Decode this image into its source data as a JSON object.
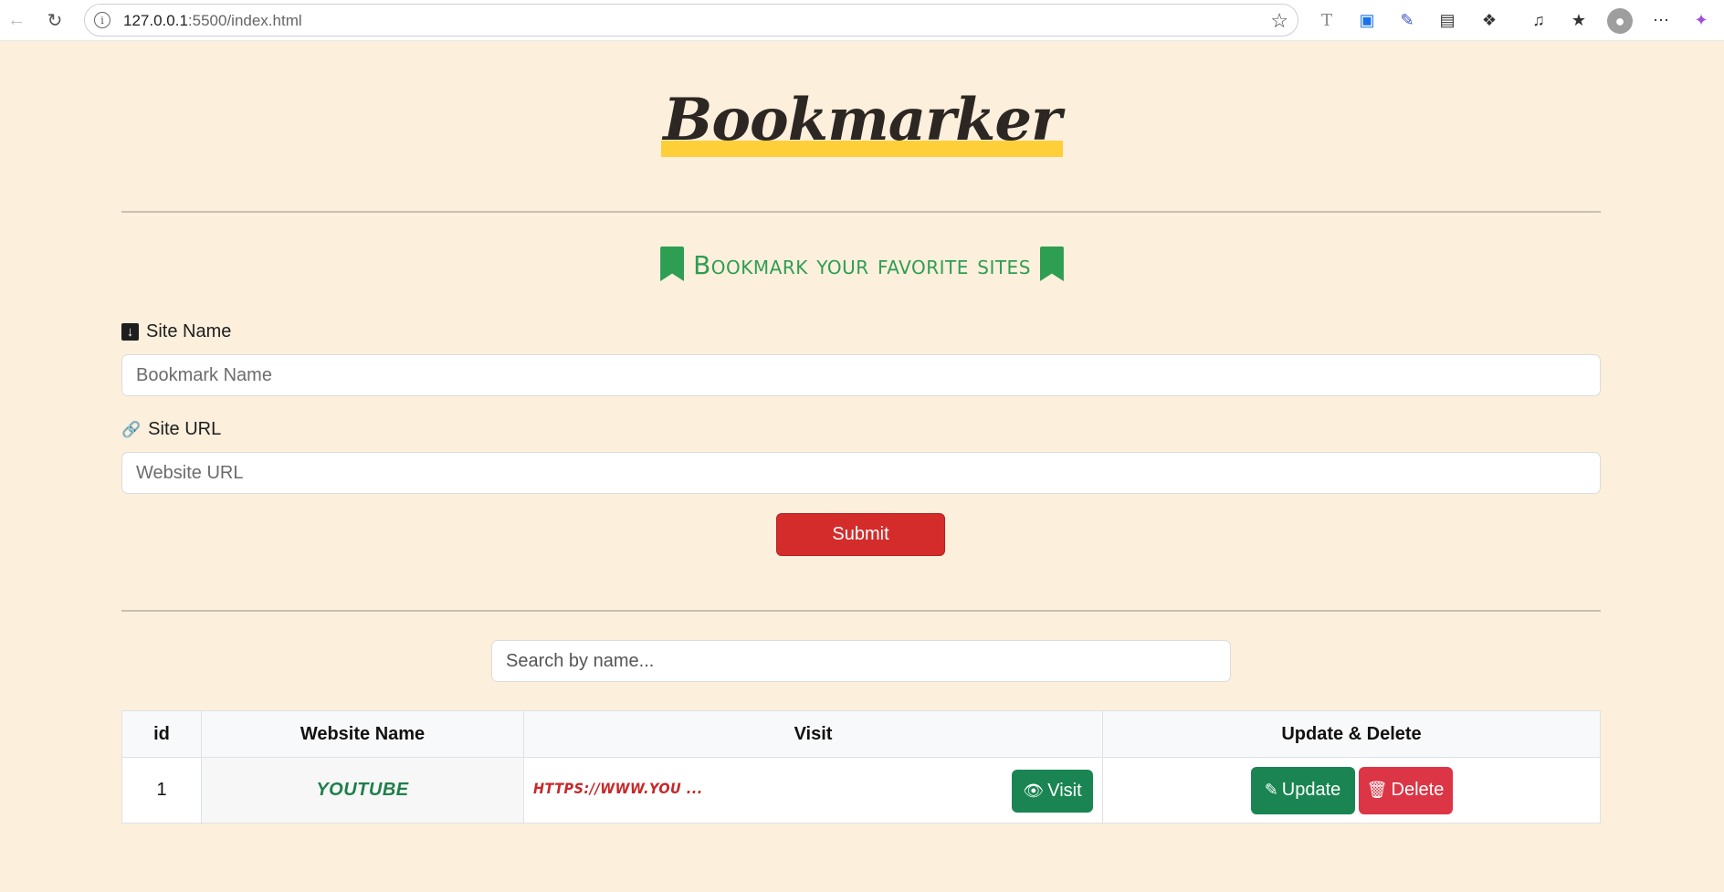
{
  "browser": {
    "url_host": "127.0.0.1",
    "url_rest": ":5500/index.html"
  },
  "page": {
    "logo": "Bookmarker",
    "subtitle": "Bookmark your favorite sites",
    "site_name_label": "Site Name",
    "site_name_placeholder": "Bookmark Name",
    "site_url_label": "Site URL",
    "site_url_placeholder": "Website URL",
    "submit_label": "Submit",
    "search_placeholder": "Search by name..."
  },
  "table": {
    "headers": [
      "id",
      "Website Name",
      "Visit",
      "Update & Delete"
    ],
    "rows": [
      {
        "id": "1",
        "name": "YOUTUBE",
        "url": "HTTPS://WWW.YOU ...",
        "visit_label": "Visit",
        "update_label": "Update",
        "delete_label": "Delete"
      }
    ]
  },
  "colors": {
    "background": "#fcefdc",
    "accent_green": "#2e9e53",
    "submit_red": "#d42b2b",
    "logo_highlight": "#ffcf3a"
  }
}
